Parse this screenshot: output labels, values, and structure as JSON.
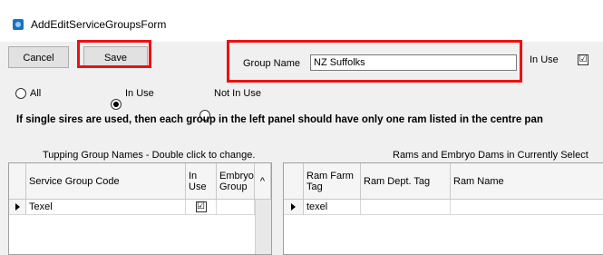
{
  "window": {
    "title": "AddEditServiceGroupsForm",
    "icon": "app-icon"
  },
  "toolbar": {
    "cancel_label": "Cancel",
    "save_label": "Save"
  },
  "group": {
    "name_label": "Group Name",
    "name_value": "NZ Suffolks",
    "in_use_label": "In Use",
    "in_use_checked": "☑"
  },
  "filter": {
    "all_label": "All",
    "in_use_label": "In Use",
    "not_in_use_label": "Not In Use",
    "selected": "In Use"
  },
  "note": "If single sires are used, then each group in the left panel should have only one ram listed in the centre pan",
  "left_panel": {
    "caption": "Tupping Group Names - Double click to change.",
    "columns": [
      "Service Group Code",
      "In Use",
      "Embryo Group"
    ],
    "rows": [
      {
        "code": "Texel",
        "in_use": "☑",
        "embryo": ""
      }
    ]
  },
  "right_panel": {
    "caption": "Rams and Embryo Dams in Currently Select",
    "columns": [
      "Ram Farm Tag",
      "Ram Dept. Tag",
      "Ram Name"
    ],
    "rows": [
      {
        "farm_tag": "texel",
        "dept_tag": "",
        "name": ""
      }
    ]
  },
  "colors": {
    "highlight": "#ee1111",
    "background": "#f0f0f0"
  }
}
